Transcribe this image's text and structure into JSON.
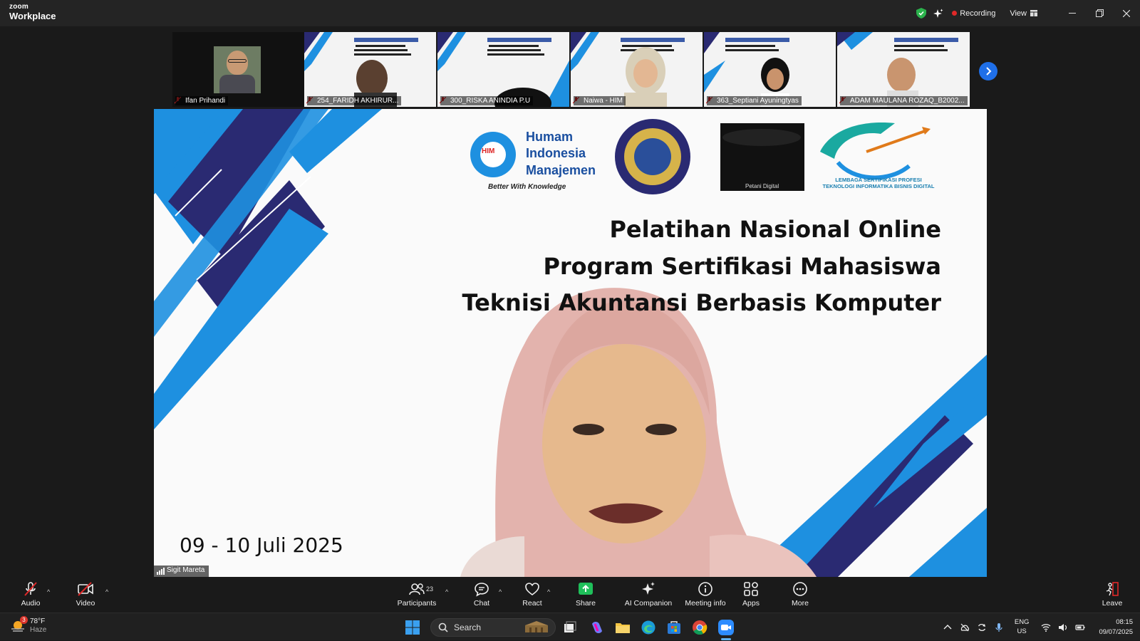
{
  "app": {
    "brand_small": "zoom",
    "brand_name": "Workplace"
  },
  "titlebar": {
    "recording_label": "Recording",
    "view_label": "View"
  },
  "gallery": [
    {
      "name": "Ifan Prihandi",
      "type": "camera"
    },
    {
      "name": "254_FARIDH AKHIRUR...",
      "type": "slide"
    },
    {
      "name": "300_RISKA ANINDIA P.U",
      "type": "slide"
    },
    {
      "name": "Naiwa - HIM",
      "type": "slide"
    },
    {
      "name": "363_Septiani Ayuningtyas",
      "type": "slide"
    },
    {
      "name": "ADAM MAULANA ROZAQ_B2002...",
      "type": "slide"
    }
  ],
  "stage": {
    "logo_him": [
      "Humam",
      "Indonesia",
      "Manajemen"
    ],
    "logo_him_tagline": "Better With Knowledge",
    "logo_him_badge": "HIM",
    "logo_petani": "Petani Digital",
    "logo_lsp_1": "LEMBAGA SERTIFIKASI PROFESI",
    "logo_lsp_2": "TEKNOLOGI INFORMATIKA BISNIS DIGITAL",
    "title_line1": "Pelatihan Nasional Online",
    "title_line2": "Program Sertifikasi Mahasiswa",
    "title_line3": "Teknisi Akuntansi Berbasis Komputer",
    "date": "09 - 10 Juli 2025",
    "speaker_name": "Sigit Mareta"
  },
  "toolbar": {
    "audio": "Audio",
    "video": "Video",
    "participants": "Participants",
    "participants_count": "23",
    "chat": "Chat",
    "react": "React",
    "share": "Share",
    "ai_companion": "AI Companion",
    "meeting_info": "Meeting info",
    "apps": "Apps",
    "more": "More",
    "leave": "Leave"
  },
  "taskbar": {
    "weather_temp": "78°F",
    "weather_cond": "Haze",
    "weather_badge": "3",
    "search_placeholder": "Search",
    "lang_1": "ENG",
    "lang_2": "US",
    "time": "08:15",
    "date": "09/07/2025"
  },
  "colors": {
    "accent_blue": "#1f6fe8",
    "slide_dark_navy": "#2a2a72",
    "slide_light_blue": "#1e90e0",
    "share_green": "#1fbf5a",
    "leave_red": "#e02828"
  }
}
